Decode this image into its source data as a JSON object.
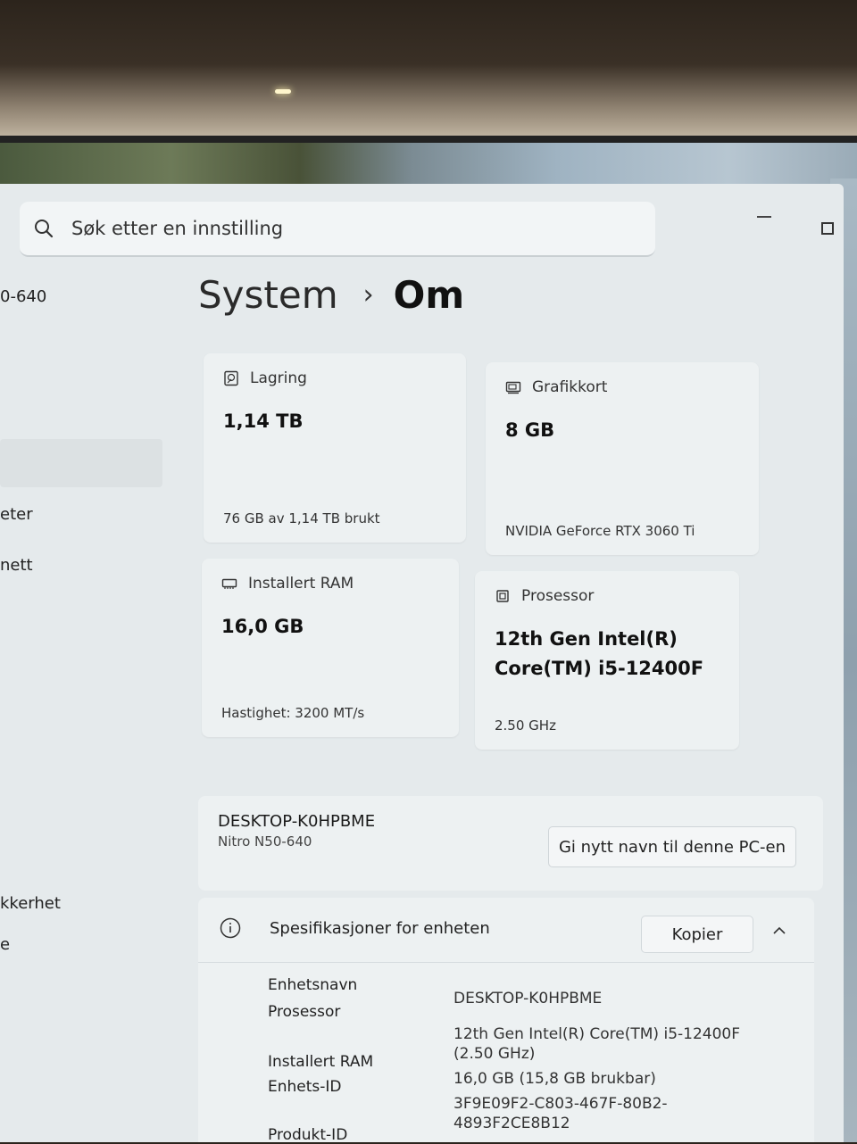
{
  "search": {
    "placeholder": "Søk etter en innstilling"
  },
  "sidebar": {
    "device_fragment": "0-640",
    "items": [
      {
        "label": "eter"
      },
      {
        "label": "nett"
      },
      {
        "label": "kkerhet"
      },
      {
        "label": "e"
      }
    ]
  },
  "breadcrumb": {
    "parent": "System",
    "separator": "›",
    "current": "Om"
  },
  "cards": {
    "storage": {
      "label": "Lagring",
      "value": "1,14 TB",
      "footer": "76 GB av 1,14 TB brukt"
    },
    "gpu": {
      "label": "Grafikkort",
      "value": "8 GB",
      "footer": "NVIDIA GeForce RTX 3060 Ti"
    },
    "ram": {
      "label": "Installert RAM",
      "value": "16,0 GB",
      "footer": "Hastighet: 3200 MT/s"
    },
    "cpu": {
      "label": "Prosessor",
      "value_line1": "12th Gen Intel(R)",
      "value_line2": "Core(TM) i5-12400F",
      "footer": "2.50 GHz"
    }
  },
  "pc": {
    "name": "DESKTOP-K0HPBME",
    "model": "Nitro N50-640",
    "rename_label": "Gi nytt navn til denne PC-en"
  },
  "specs": {
    "title": "Spesifikasjoner for enheten",
    "copy_label": "Kopier",
    "rows": [
      {
        "label": "Enhetsnavn",
        "value": "DESKTOP-K0HPBME"
      },
      {
        "label": "Prosessor",
        "value": "12th Gen Intel(R) Core(TM) i5-12400F (2.50 GHz)"
      },
      {
        "label": "Installert RAM",
        "value": "16,0 GB (15,8 GB brukbar)"
      },
      {
        "label": "Enhets-ID",
        "value": "3F9E09F2-C803-467F-80B2-4893F2CE8B12"
      },
      {
        "label": "Produkt-ID",
        "value": ""
      }
    ]
  }
}
